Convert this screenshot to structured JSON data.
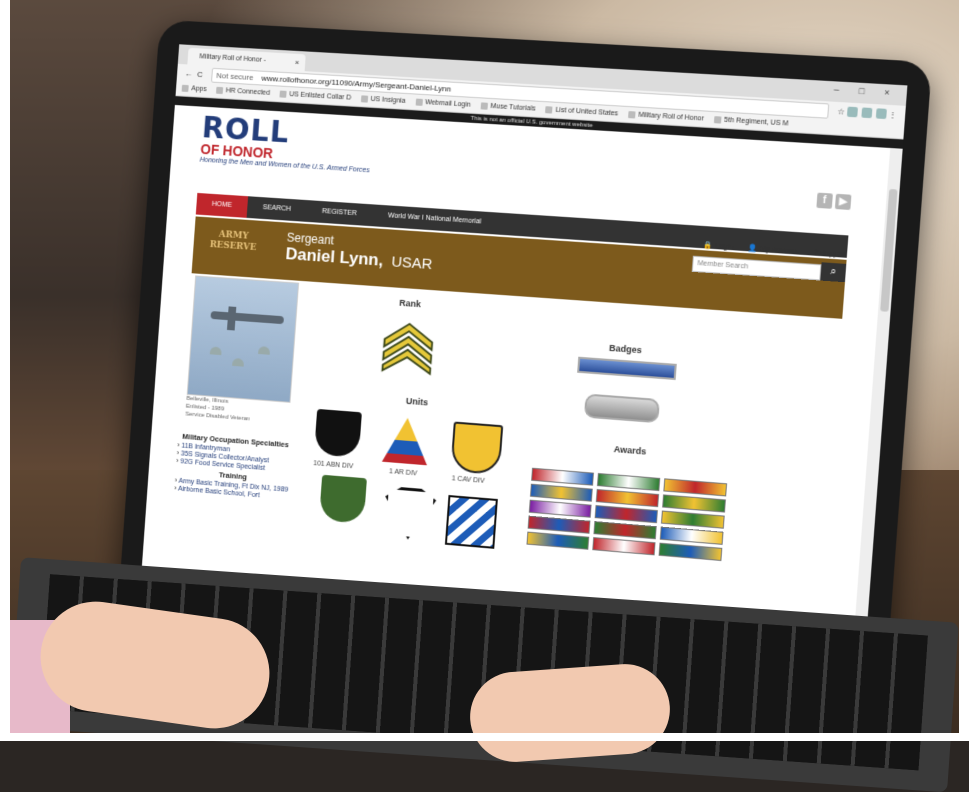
{
  "browser": {
    "tab_title": "Military Roll of Honor - ",
    "not_secure": "Not secure",
    "url": "www.rollofhonor.org/11090/Army/Sergeant-Daniel-Lynn",
    "bookmarks": [
      "Apps",
      "HR Connected",
      "US Enlisted Collar D",
      "US Insignia",
      "Webmail Login",
      "Muse Tutorials",
      "List of United States",
      "Military Roll of Honor",
      "5th Regiment, US M"
    ],
    "gov_banner": "This is not an official U.S. government website"
  },
  "site": {
    "logo_line1": "ROLL",
    "logo_line2": "OF HONOR",
    "tagline": "Honoring the Men and Women of the U.S. Armed Forces",
    "nav": [
      "HOME",
      "SEARCH",
      "REGISTER",
      "World War I National Memorial"
    ],
    "util": {
      "login": "Login",
      "account": "My Account",
      "support": "Support"
    },
    "search_placeholder": "Member Search",
    "social": [
      "f",
      "▶"
    ]
  },
  "profile": {
    "branch_logo": "ARMY RESERVE",
    "rank": "Sergeant",
    "name": "Daniel Lynn,",
    "branch": "USAR",
    "caption_lines": [
      "Belleville, Illinois",
      "Enlisted - 1989",
      "Service Disabled Veteran"
    ]
  },
  "sidebar": {
    "mos_title": "Military Occupation Specialties",
    "mos": [
      "11B Infantryman",
      "35S Signals Collector/Analyst",
      "92G Food Service Specialist"
    ],
    "training_title": "Training",
    "training": [
      "Army Basic Training, Ft Dix NJ, 1989",
      "Airborne Basic School, Fort"
    ]
  },
  "sections": {
    "rank": "Rank",
    "badges": "Badges",
    "units": "Units",
    "awards": "Awards"
  },
  "units": [
    "101 ABN DIV",
    "1 AR DIV",
    "1 CAV DIV"
  ],
  "colors": {
    "brand_red": "#c0262c",
    "brand_blue": "#233d7a",
    "banner_brown": "#7d5a1c",
    "nav_dark": "#333333"
  }
}
